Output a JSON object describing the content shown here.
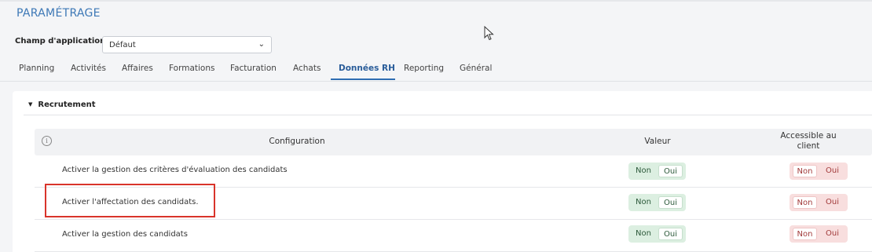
{
  "page": {
    "title": "PARAMÉTRAGE"
  },
  "scope": {
    "label": "Champ d'application",
    "value": "Défaut"
  },
  "tabs": [
    {
      "label": "Planning"
    },
    {
      "label": "Activités"
    },
    {
      "label": "Affaires"
    },
    {
      "label": "Formations"
    },
    {
      "label": "Facturation"
    },
    {
      "label": "Achats"
    },
    {
      "label": "Données RH",
      "active": true
    },
    {
      "label": "Reporting"
    },
    {
      "label": "Général"
    }
  ],
  "section": {
    "title": "Recrutement"
  },
  "table": {
    "headers": {
      "config": "Configuration",
      "value": "Valeur",
      "client": "Accessible au client"
    },
    "rows": [
      {
        "label": "Activer la gestion des critères d'évaluation des candidats",
        "value": {
          "non": "Non",
          "oui": "Oui",
          "selected": "Oui"
        },
        "client": {
          "non": "Non",
          "oui": "Oui",
          "selected": "Non"
        }
      },
      {
        "label": "Activer l'affectation des candidats.",
        "value": {
          "non": "Non",
          "oui": "Oui",
          "selected": "Oui"
        },
        "client": {
          "non": "Non",
          "oui": "Oui",
          "selected": "Non"
        }
      },
      {
        "label": "Activer la gestion des candidats",
        "value": {
          "non": "Non",
          "oui": "Oui",
          "selected": "Oui"
        },
        "client": {
          "non": "Non",
          "oui": "Oui",
          "selected": "Non"
        }
      }
    ]
  },
  "colors": {
    "accent": "#3d78b6",
    "highlight": "#d9342b",
    "toggle_green": "#dcefe1",
    "toggle_red": "#f8dede"
  }
}
